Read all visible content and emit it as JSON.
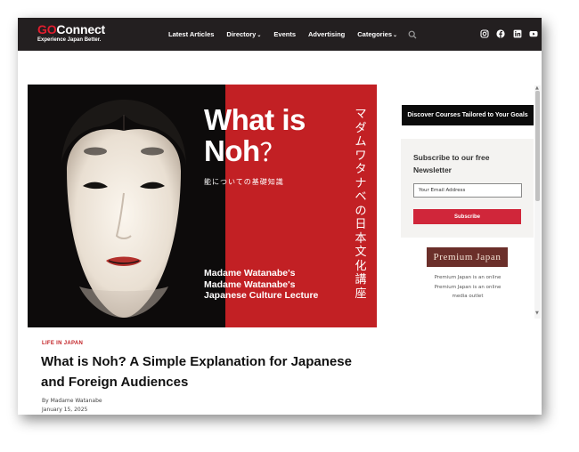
{
  "header": {
    "logo_go": "GO",
    "logo_connect": "Connect",
    "logo_tagline": "Experience Japan Better.",
    "nav": [
      {
        "label": "Latest Articles",
        "chevron": ""
      },
      {
        "label": "Directory",
        "chevron": "⌄"
      },
      {
        "label": "Events",
        "chevron": ""
      },
      {
        "label": "Advertising",
        "chevron": ""
      },
      {
        "label": "Categories",
        "chevron": "⌄"
      }
    ],
    "search_icon": "search-icon",
    "social_icons": [
      "instagram-icon",
      "facebook-icon",
      "linkedin-icon",
      "youtube-icon"
    ]
  },
  "hero": {
    "title_line1": "What is",
    "title_line2": "Noh",
    "title_mark": "？",
    "subtitle_jp": "能についての基礎知識",
    "vertical_jp": "マダムワタナベの日本文化講座",
    "lecture_line1": "Madame Watanabe's",
    "lecture_line2": "Madame Watanabe's",
    "lecture_line3": "Japanese Culture Lecture"
  },
  "article": {
    "category": "LIFE IN JAPAN",
    "title": "What is Noh? A Simple Explanation for Japanese and Foreign Audiences",
    "byline": "By Madame Watanabe",
    "date": "January 15, 2025"
  },
  "sidebar": {
    "discover_label": "Discover Courses Tailored to Your Goals",
    "newsletter_heading": "Subscribe to our free Newsletter",
    "email_placeholder": "Your Email Address",
    "subscribe_label": "Subscribe",
    "pj_banner": "Premium Japan",
    "pj_text1": "Premium Japan is an online",
    "pj_text2": "Premium Japan is an online",
    "pj_text3": "media outlet"
  },
  "colors": {
    "header_bg": "#231f20",
    "brand_red": "#e11d2e",
    "hero_red": "#c22024",
    "subscribe_button": "#d0263a",
    "premium_japan": "#6b2f2a"
  }
}
